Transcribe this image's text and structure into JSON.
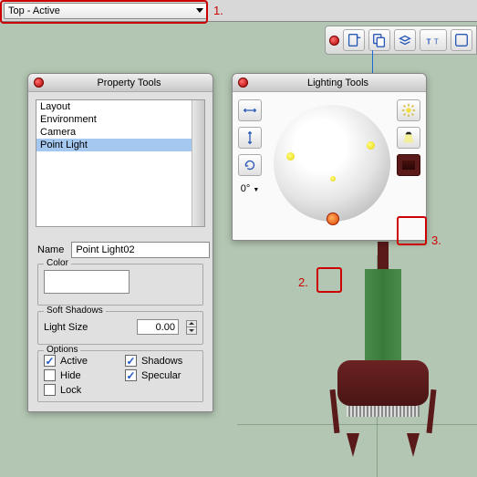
{
  "topbar": {
    "dropdown_value": "Top - Active"
  },
  "callouts": {
    "n1": "1.",
    "n2": "2.",
    "n3": "3."
  },
  "property_panel": {
    "title": "Property Tools",
    "list": [
      "Layout",
      "Environment",
      "Camera",
      "Point Light"
    ],
    "selected_index": 3,
    "name_label": "Name",
    "name_value": "Point Light02",
    "color_label": "Color",
    "soft_shadows_label": "Soft Shadows",
    "light_size_label": "Light Size",
    "light_size_value": "0.00",
    "options_label": "Options",
    "opts": {
      "active": {
        "label": "Active",
        "checked": true
      },
      "shadows": {
        "label": "Shadows",
        "checked": true
      },
      "hide": {
        "label": "Hide",
        "checked": false
      },
      "specular": {
        "label": "Specular",
        "checked": true
      },
      "lock": {
        "label": "Lock",
        "checked": false
      }
    }
  },
  "lighting_panel": {
    "title": "Lighting Tools",
    "rotation_label": "0°",
    "color_swatch": "#5a1a1a"
  }
}
